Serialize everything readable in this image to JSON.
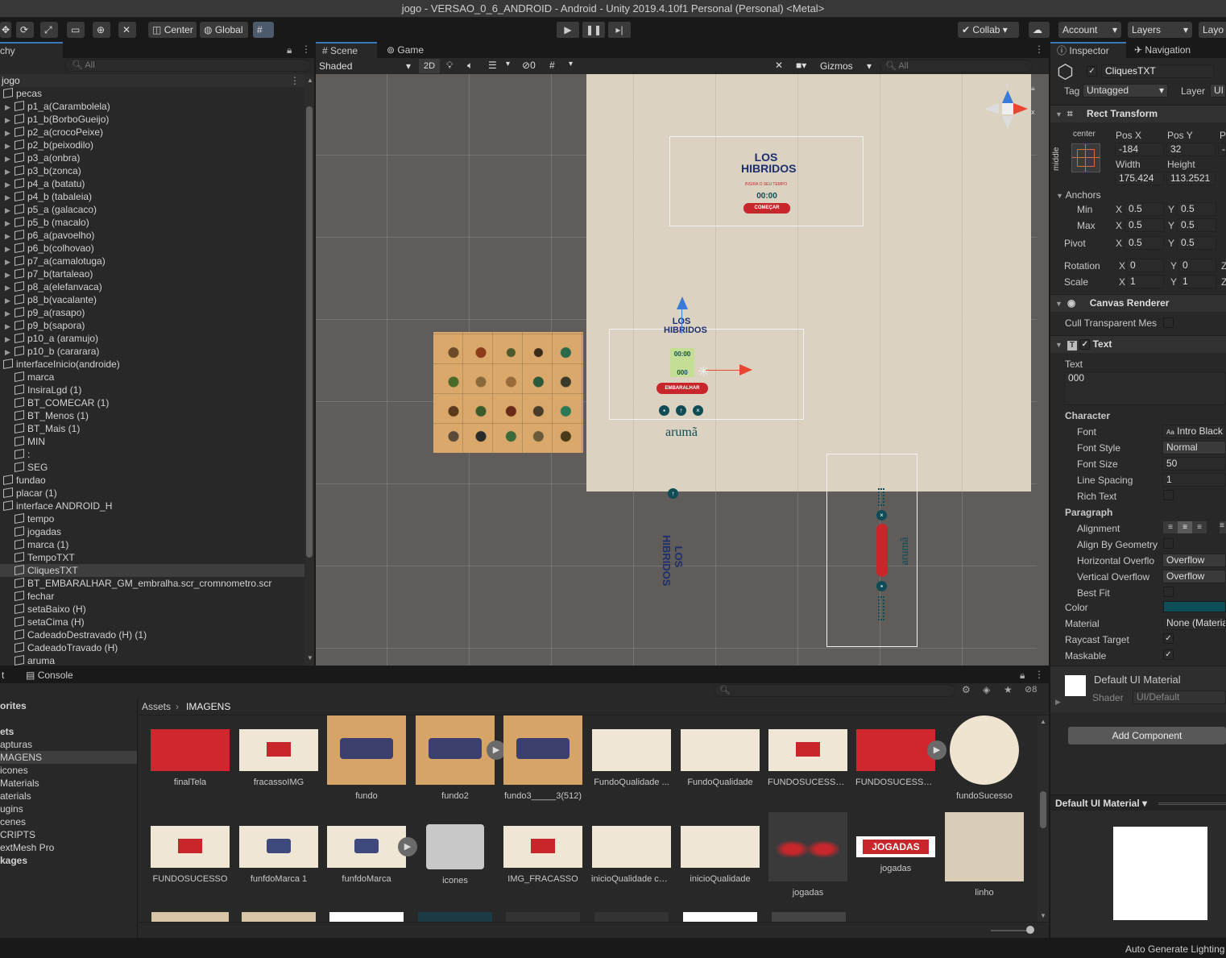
{
  "window": {
    "title": "jogo - VERSAO_0_6_ANDROID - Android - Unity 2019.4.10f1 Personal (Personal) <Metal>"
  },
  "toolbar": {
    "pivot": "Center",
    "space": "Global",
    "collab": "Collab",
    "account": "Account",
    "layers": "Layers",
    "layout": "Layo"
  },
  "hierarchy": {
    "tab": "chy",
    "search_placeholder": "All",
    "scene_name": "jogo",
    "items": [
      {
        "label": "pecas",
        "indent": 0
      },
      {
        "label": "p1_a(Carambolela)",
        "indent": 1
      },
      {
        "label": "p1_b(BorboGueijo)",
        "indent": 1
      },
      {
        "label": "p2_a(crocoPeixe)",
        "indent": 1
      },
      {
        "label": "p2_b(peixodilo)",
        "indent": 1
      },
      {
        "label": "p3_a(onbra)",
        "indent": 1
      },
      {
        "label": "p3_b(zonca)",
        "indent": 1
      },
      {
        "label": "p4_a (batatu)",
        "indent": 1
      },
      {
        "label": "p4_b (tabaleia)",
        "indent": 1
      },
      {
        "label": "p5_a (galacaco)",
        "indent": 1
      },
      {
        "label": "p5_b (macalo)",
        "indent": 1
      },
      {
        "label": "p6_a(pavoelho)",
        "indent": 1
      },
      {
        "label": "p6_b(colhovao)",
        "indent": 1
      },
      {
        "label": "p7_a(camalotuga)",
        "indent": 1
      },
      {
        "label": "p7_b(tartaleao)",
        "indent": 1
      },
      {
        "label": "p8_a(elefanvaca)",
        "indent": 1
      },
      {
        "label": "p8_b(vacalante)",
        "indent": 1
      },
      {
        "label": "p9_a(rasapo)",
        "indent": 1
      },
      {
        "label": "p9_b(sapora)",
        "indent": 1
      },
      {
        "label": "p10_a (aramujo)",
        "indent": 1
      },
      {
        "label": "p10_b (cararara)",
        "indent": 1
      },
      {
        "label": "interfaceInicio(androide)",
        "indent": 0
      },
      {
        "label": "marca",
        "indent": 1
      },
      {
        "label": "InsiraLgd (1)",
        "indent": 1
      },
      {
        "label": "BT_COMECAR (1)",
        "indent": 1
      },
      {
        "label": "BT_Menos (1)",
        "indent": 1
      },
      {
        "label": "BT_Mais (1)",
        "indent": 1
      },
      {
        "label": "MIN",
        "indent": 1
      },
      {
        "label": ":",
        "indent": 1
      },
      {
        "label": "SEG",
        "indent": 1
      },
      {
        "label": "fundao",
        "indent": 0
      },
      {
        "label": "placar (1)",
        "indent": 0
      },
      {
        "label": "interface ANDROID_H",
        "indent": 0
      },
      {
        "label": "tempo",
        "indent": 1
      },
      {
        "label": "jogadas",
        "indent": 1
      },
      {
        "label": "marca (1)",
        "indent": 1
      },
      {
        "label": "TempoTXT",
        "indent": 1
      },
      {
        "label": "CliquesTXT",
        "indent": 1,
        "selected": true
      },
      {
        "label": "BT_EMBARALHAR_GM_embralha.scr_cromnometro.scr",
        "indent": 1
      },
      {
        "label": "fechar",
        "indent": 1
      },
      {
        "label": "setaBaixo (H)",
        "indent": 1
      },
      {
        "label": "setaCima (H)",
        "indent": 1
      },
      {
        "label": "CadeadoDestravado (H) (1)",
        "indent": 1
      },
      {
        "label": "CadeadoTravado (H)",
        "indent": 1
      },
      {
        "label": "aruma",
        "indent": 1
      }
    ]
  },
  "scene": {
    "tab_scene": "Scene",
    "tab_game": "Game",
    "shading": "Shaded",
    "mode_2d": "2D",
    "hidden_count": "0",
    "gizmos": "Gizmos",
    "search_placeholder": "All",
    "ui_texts": {
      "logo": "LOS HIBRIDOS",
      "insira": "INSIRA O SEU TEMPO",
      "timer": "00:00",
      "comecar": "COMEÇAR",
      "embaralhar": "EMBARALHAR",
      "aruma": "arumã",
      "score_a": "00:00",
      "score_b": "000"
    }
  },
  "inspector": {
    "tab_inspector": "Inspector",
    "tab_navigation": "Navigation",
    "object_name": "CliquesTXT",
    "tag_label": "Tag",
    "tag_value": "Untagged",
    "layer_label": "Layer",
    "layer_value": "UI",
    "rect_transform": {
      "title": "Rect Transform",
      "anchor_h": "center",
      "anchor_v": "middle",
      "pos_x_label": "Pos X",
      "pos_y_label": "Pos Y",
      "pos_z_label": "P",
      "pos_x": "-184",
      "pos_y": "32",
      "pos_z": "-",
      "width_label": "Width",
      "height_label": "Height",
      "width": "175.424",
      "height": "113.2521",
      "anchors_label": "Anchors",
      "min_label": "Min",
      "max_label": "Max",
      "pivot_label": "Pivot",
      "min_x": "0.5",
      "min_y": "0.5",
      "max_x": "0.5",
      "max_y": "0.5",
      "pivot_x": "0.5",
      "pivot_y": "0.5",
      "rotation_label": "Rotation",
      "rot_x": "0",
      "rot_y": "0",
      "scale_label": "Scale",
      "scale_x": "1",
      "scale_y": "1",
      "x": "X",
      "y": "Y",
      "z": "Z"
    },
    "canvas_renderer": {
      "title": "Canvas Renderer",
      "cull_label": "Cull Transparent Mes"
    },
    "text": {
      "title": "Text",
      "text_label": "Text",
      "text_value": "000",
      "character_label": "Character",
      "font_label": "Font",
      "font_value": "Intro Black",
      "font_style_label": "Font Style",
      "font_style_value": "Normal",
      "font_size_label": "Font Size",
      "font_size_value": "50",
      "line_spacing_label": "Line Spacing",
      "line_spacing_value": "1",
      "rich_text_label": "Rich Text",
      "paragraph_label": "Paragraph",
      "alignment_label": "Alignment",
      "align_geom_label": "Align By Geometry",
      "h_overflow_label": "Horizontal Overflo",
      "h_overflow_value": "Overflow",
      "v_overflow_label": "Vertical Overflow",
      "v_overflow_value": "Overflow",
      "best_fit_label": "Best Fit",
      "color_label": "Color",
      "color_value": "#0d4f57",
      "material_label": "Material",
      "material_value": "None (Materia",
      "raycast_label": "Raycast Target",
      "maskable_label": "Maskable"
    },
    "material_block": {
      "name": "Default UI Material",
      "shader_label": "Shader",
      "shader_value": "UI/Default"
    },
    "add_component": "Add Component",
    "preview_title": "Default UI Material"
  },
  "project": {
    "tab_project": "t",
    "tab_console": "Console",
    "hidden_count": "8",
    "breadcrumb_root": "Assets",
    "breadcrumb_current": "IMAGENS",
    "tree": [
      {
        "label": "orites",
        "bold": true
      },
      {
        "label": "",
        "bold": false
      },
      {
        "label": "ets",
        "bold": true
      },
      {
        "label": "apturas",
        "bold": false
      },
      {
        "label": "MAGENS",
        "bold": false,
        "selected": true
      },
      {
        "label": "icones",
        "bold": false
      },
      {
        "label": "Materials",
        "bold": false
      },
      {
        "label": "aterials",
        "bold": false
      },
      {
        "label": "ugins",
        "bold": false
      },
      {
        "label": "cenes",
        "bold": false
      },
      {
        "label": "CRIPTS",
        "bold": false
      },
      {
        "label": "extMesh Pro",
        "bold": false
      },
      {
        "label": "kages",
        "bold": true
      }
    ],
    "assets_row1": [
      {
        "name": "finalTela",
        "kind": "red"
      },
      {
        "name": "fracassoIMG",
        "kind": "cream-red"
      },
      {
        "name": "fundo",
        "kind": "wood"
      },
      {
        "name": "fundo2",
        "kind": "wood",
        "play": true
      },
      {
        "name": "fundo3_____3(512)",
        "kind": "wood"
      },
      {
        "name": "FundoQualidade ...",
        "kind": "cream"
      },
      {
        "name": "FundoQualidade",
        "kind": "cream"
      },
      {
        "name": "FUNDOSUCESSO...",
        "kind": "cream-red"
      },
      {
        "name": "FUNDOSUCESSO...",
        "kind": "red",
        "play": true
      },
      {
        "name": "fundoSucesso",
        "kind": "circle"
      }
    ],
    "assets_row2": [
      {
        "name": "FUNDOSUCESSO",
        "kind": "cream-red"
      },
      {
        "name": "funfdoMarca 1",
        "kind": "cream-logo"
      },
      {
        "name": "funfdoMarca",
        "kind": "cream-logo",
        "play": true
      },
      {
        "name": "icones",
        "kind": "folder"
      },
      {
        "name": "IMG_FRACASSO",
        "kind": "cream-red"
      },
      {
        "name": "inicioQualidade cópia",
        "kind": "cream"
      },
      {
        "name": "inicioQualidade",
        "kind": "cream"
      },
      {
        "name": "jogadas",
        "kind": "flames"
      },
      {
        "name": "jogadas",
        "kind": "jogadas",
        "label": "JOGADAS"
      },
      {
        "name": "linho",
        "kind": "linen"
      }
    ]
  },
  "statusbar": {
    "text": "Auto Generate Lighting"
  }
}
